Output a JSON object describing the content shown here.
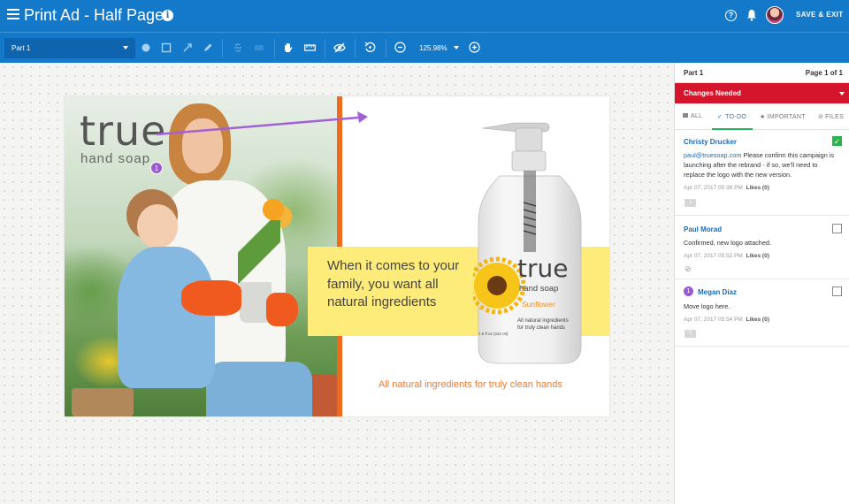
{
  "header": {
    "title": "Print Ad - Half Page",
    "save_exit": "SAVE & EXIT"
  },
  "toolbar": {
    "part_select": "Part 1",
    "zoom": "125.98%",
    "tools": [
      "circle-tool-icon",
      "rectangle-tool-icon",
      "arrow-tool-icon",
      "pen-tool-icon",
      "strikethrough-tool-icon",
      "highlight-tool-icon",
      "hand-tool-icon",
      "ruler-tool-icon",
      "hide-markup-icon",
      "rotate-icon",
      "zoom-out-icon",
      "zoom-in-icon"
    ]
  },
  "ad": {
    "logo_word": "true",
    "logo_sub": "hand soap",
    "headline": "When it comes to your family, you want all natural ingredients",
    "bottle_brand": "true",
    "bottle_sub": "hand soap",
    "bottle_variant": "Sunflower",
    "bottle_desc_1": "All natural ingredients",
    "bottle_desc_2": "for truly clean hands",
    "bottle_size": "7.5 fl oz (221 ml)",
    "tagline": "All natural ingredients for truly clean hands",
    "pin_number": "1",
    "colors": {
      "orange": "#f06a1d",
      "yellow": "#fdec7a",
      "annotation": "#9b59d0"
    }
  },
  "panel": {
    "part": "Part 1",
    "page": "Page 1 of 1",
    "status": "Changes Needed",
    "tabs": [
      "ALL",
      "TO-DO",
      "IMPORTANT",
      "FILES"
    ],
    "active_tab": "TO-DO",
    "comments": [
      {
        "name": "Christy Drucker",
        "email": "paul@truesoap.com",
        "text": " Please confirm this campaign is launching after the rebrand - if so, we'll need to replace the logo with the new version.",
        "date": "Apr 07, 2017 05:38 PM",
        "likes_label": "Likes (0)",
        "checked": true,
        "replies": "1"
      },
      {
        "name": "Paul Morad",
        "text": "Confirmed, new logo attached.",
        "date": "Apr 07, 2017 05:52 PM",
        "likes_label": "Likes (0)",
        "checked": false
      },
      {
        "number": "1",
        "name": "Megan Diaz",
        "text": "Move logo here.",
        "date": "Apr 07, 2017 05:54 PM",
        "likes_label": "Likes (0)",
        "checked": false,
        "replies": "0"
      }
    ]
  }
}
